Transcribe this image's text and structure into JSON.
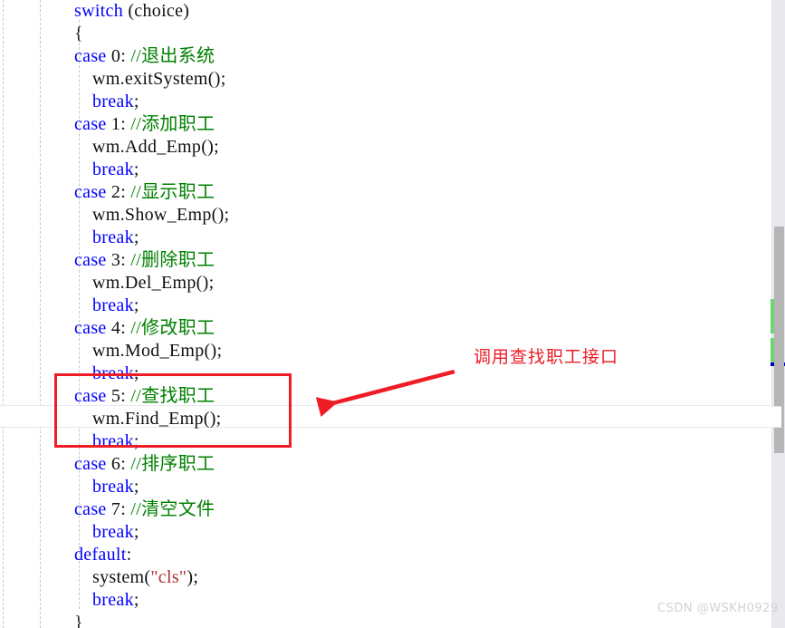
{
  "editor": {
    "language": "cpp",
    "font_size_px": 20,
    "indent_guides": 3,
    "lines": [
      {
        "indent": 4,
        "segments": [
          {
            "t": "switch",
            "c": "kw"
          },
          {
            "t": " (choice)",
            "c": "plain"
          }
        ]
      },
      {
        "indent": 4,
        "segments": [
          {
            "t": "{",
            "c": "punct"
          }
        ]
      },
      {
        "indent": 4,
        "segments": [
          {
            "t": "case",
            "c": "kw"
          },
          {
            "t": " 0: ",
            "c": "plain"
          },
          {
            "t": "//退出系统",
            "c": "cmt"
          }
        ]
      },
      {
        "indent": 6,
        "segments": [
          {
            "t": "wm.exitSystem();",
            "c": "plain"
          }
        ]
      },
      {
        "indent": 6,
        "segments": [
          {
            "t": "break",
            "c": "kw"
          },
          {
            "t": ";",
            "c": "plain"
          }
        ]
      },
      {
        "indent": 4,
        "segments": [
          {
            "t": "case",
            "c": "kw"
          },
          {
            "t": " 1: ",
            "c": "plain"
          },
          {
            "t": "//添加职工",
            "c": "cmt"
          }
        ]
      },
      {
        "indent": 6,
        "segments": [
          {
            "t": "wm.Add_Emp();",
            "c": "plain"
          }
        ]
      },
      {
        "indent": 6,
        "segments": [
          {
            "t": "break",
            "c": "kw"
          },
          {
            "t": ";",
            "c": "plain"
          }
        ]
      },
      {
        "indent": 4,
        "segments": [
          {
            "t": "case",
            "c": "kw"
          },
          {
            "t": " 2: ",
            "c": "plain"
          },
          {
            "t": "//显示职工",
            "c": "cmt"
          }
        ]
      },
      {
        "indent": 6,
        "segments": [
          {
            "t": "wm.Show_Emp();",
            "c": "plain"
          }
        ]
      },
      {
        "indent": 6,
        "segments": [
          {
            "t": "break",
            "c": "kw"
          },
          {
            "t": ";",
            "c": "plain"
          }
        ]
      },
      {
        "indent": 4,
        "segments": [
          {
            "t": "case",
            "c": "kw"
          },
          {
            "t": " 3: ",
            "c": "plain"
          },
          {
            "t": "//删除职工",
            "c": "cmt"
          }
        ]
      },
      {
        "indent": 6,
        "segments": [
          {
            "t": "wm.Del_Emp();",
            "c": "plain"
          }
        ]
      },
      {
        "indent": 6,
        "segments": [
          {
            "t": "break",
            "c": "kw"
          },
          {
            "t": ";",
            "c": "plain"
          }
        ]
      },
      {
        "indent": 4,
        "segments": [
          {
            "t": "case",
            "c": "kw"
          },
          {
            "t": " 4: ",
            "c": "plain"
          },
          {
            "t": "//修改职工",
            "c": "cmt"
          }
        ]
      },
      {
        "indent": 6,
        "segments": [
          {
            "t": "wm.Mod_Emp();",
            "c": "plain"
          }
        ]
      },
      {
        "indent": 6,
        "segments": [
          {
            "t": "break",
            "c": "kw"
          },
          {
            "t": ";",
            "c": "plain"
          }
        ]
      },
      {
        "indent": 4,
        "segments": [
          {
            "t": "case",
            "c": "kw"
          },
          {
            "t": " 5: ",
            "c": "plain"
          },
          {
            "t": "//查找职工",
            "c": "cmt"
          }
        ]
      },
      {
        "indent": 6,
        "segments": [
          {
            "t": "wm.Find_Emp();",
            "c": "plain"
          }
        ]
      },
      {
        "indent": 6,
        "segments": [
          {
            "t": "break",
            "c": "kw"
          },
          {
            "t": ";",
            "c": "plain"
          }
        ]
      },
      {
        "indent": 4,
        "segments": [
          {
            "t": "case",
            "c": "kw"
          },
          {
            "t": " 6: ",
            "c": "plain"
          },
          {
            "t": "//排序职工",
            "c": "cmt"
          }
        ]
      },
      {
        "indent": 6,
        "segments": [
          {
            "t": "break",
            "c": "kw"
          },
          {
            "t": ";",
            "c": "plain"
          }
        ]
      },
      {
        "indent": 4,
        "segments": [
          {
            "t": "case",
            "c": "kw"
          },
          {
            "t": " 7: ",
            "c": "plain"
          },
          {
            "t": "//清空文件",
            "c": "cmt"
          }
        ]
      },
      {
        "indent": 6,
        "segments": [
          {
            "t": "break",
            "c": "kw"
          },
          {
            "t": ";",
            "c": "plain"
          }
        ]
      },
      {
        "indent": 4,
        "segments": [
          {
            "t": "default",
            "c": "kw"
          },
          {
            "t": ":",
            "c": "plain"
          }
        ]
      },
      {
        "indent": 6,
        "segments": [
          {
            "t": "system(",
            "c": "plain"
          },
          {
            "t": "\"cls\"",
            "c": "str"
          },
          {
            "t": ");",
            "c": "plain"
          }
        ]
      },
      {
        "indent": 6,
        "segments": [
          {
            "t": "break",
            "c": "kw"
          },
          {
            "t": ";",
            "c": "plain"
          }
        ]
      },
      {
        "indent": 4,
        "segments": [
          {
            "t": "}",
            "c": "punct"
          }
        ]
      }
    ]
  },
  "annotation": {
    "label": "调用查找职工接口",
    "color": "#ee1c24",
    "box": {
      "target_lines": [
        "case 5: //查找职工",
        "wm.Find_Emp();",
        "break;"
      ]
    },
    "arrow": {
      "from": "upper-right",
      "to": "lower-left"
    }
  },
  "scrollbar": {
    "thumb_color": "#b6b6b6",
    "track_color": "#e8e8ee",
    "vcs_change_color": "#6fd66f",
    "bookmark_color": "#0000c8"
  },
  "highlight": {
    "band_border_color": "#e7e7ee",
    "caret_line_text": "wm.Find_Emp();"
  },
  "watermark": {
    "text": "CSDN @WSKH0929",
    "color": "#d2d2d2"
  },
  "palette": {
    "keyword": "#0000ff",
    "comment": "#008000",
    "string": "#b03030",
    "plain": "#101010",
    "background": "#ffffff"
  }
}
